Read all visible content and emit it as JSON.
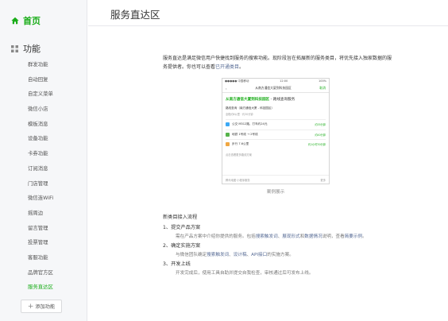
{
  "sidebar": {
    "home_label": "首页",
    "section_label": "功能",
    "items": [
      "群发功能",
      "自动回复",
      "自定义菜单",
      "微信小店",
      "模板消息",
      "设备功能",
      "卡券功能",
      "订阅消息",
      "门店管理",
      "微信连WiFi",
      "摇周边",
      "留言管理",
      "投票管理",
      "客服功能",
      "品牌官方区",
      "服务直达区"
    ],
    "active_index": 15,
    "add_label": "添加功能"
  },
  "page": {
    "title": "服务直达区",
    "intro_text": "服务直达是满足微信用户快捷找到服务的搜索功能。现阶段旨在拓展新的服务类目，将优先接入独家数据的服务提供者。你也可以查看",
    "intro_link": "已开通类目",
    "intro_end": "。"
  },
  "phone": {
    "status_left": "●●●●● 中国移动",
    "status_time": "12:00",
    "status_right": "100%",
    "nav_back": "‹",
    "nav_search": "从南方通信大厦到科技园区",
    "nav_action": "取消",
    "card_title_green": "从南方通信大厦到科技园区",
    "card_title_rest": "- 路线查询服务",
    "sub_title": "路线查询（南方通信大厦 - 科技园区）",
    "sub_info": "全程约8公里 · 约30分钟",
    "rows": [
      {
        "label": "公交 M312路，打车约24元",
        "right": "约35分钟",
        "color": "#3da9f5"
      },
      {
        "label": "地铁 1号线 → 2号线",
        "right": "约40分钟",
        "color": "#56b34a"
      },
      {
        "label": "步行 7.6公里",
        "right": "约1小时30分钟",
        "color": "#f0a742"
      }
    ],
    "more_text": "点击查看更多路线方案",
    "bottom_left": "腾讯地图·小程序服务",
    "bottom_right": "更多"
  },
  "caption": "案例展示",
  "flow": {
    "title": "新类目接入流程",
    "steps": [
      {
        "title": "1、提交产品方案",
        "desc_parts": [
          {
            "t": "需在产品方案中介绍你提供的服务。包括"
          },
          {
            "t": "搜索触发词",
            "link": true
          },
          {
            "t": "、"
          },
          {
            "t": "展现形式",
            "link": true
          },
          {
            "t": "和"
          },
          {
            "t": "数据情况",
            "link": true
          },
          {
            "t": "说明，查看"
          },
          {
            "t": "简要示例",
            "link": true
          },
          {
            "t": "。"
          }
        ]
      },
      {
        "title": "2、确定实施方案",
        "desc_parts": [
          {
            "t": "与微信团队确定"
          },
          {
            "t": "搜索触发词",
            "link": true
          },
          {
            "t": "、"
          },
          {
            "t": "设计稿",
            "link": true
          },
          {
            "t": "、"
          },
          {
            "t": "API接口",
            "link": true
          },
          {
            "t": "的实施方案。"
          }
        ]
      },
      {
        "title": "3、开发上线",
        "desc_parts": [
          {
            "t": "开发完成后，使用工具自助并提交自我检查，审核通过后可发布上线。"
          }
        ]
      }
    ]
  },
  "colors": {
    "accent": "#1aad19",
    "link": "#576b95"
  }
}
